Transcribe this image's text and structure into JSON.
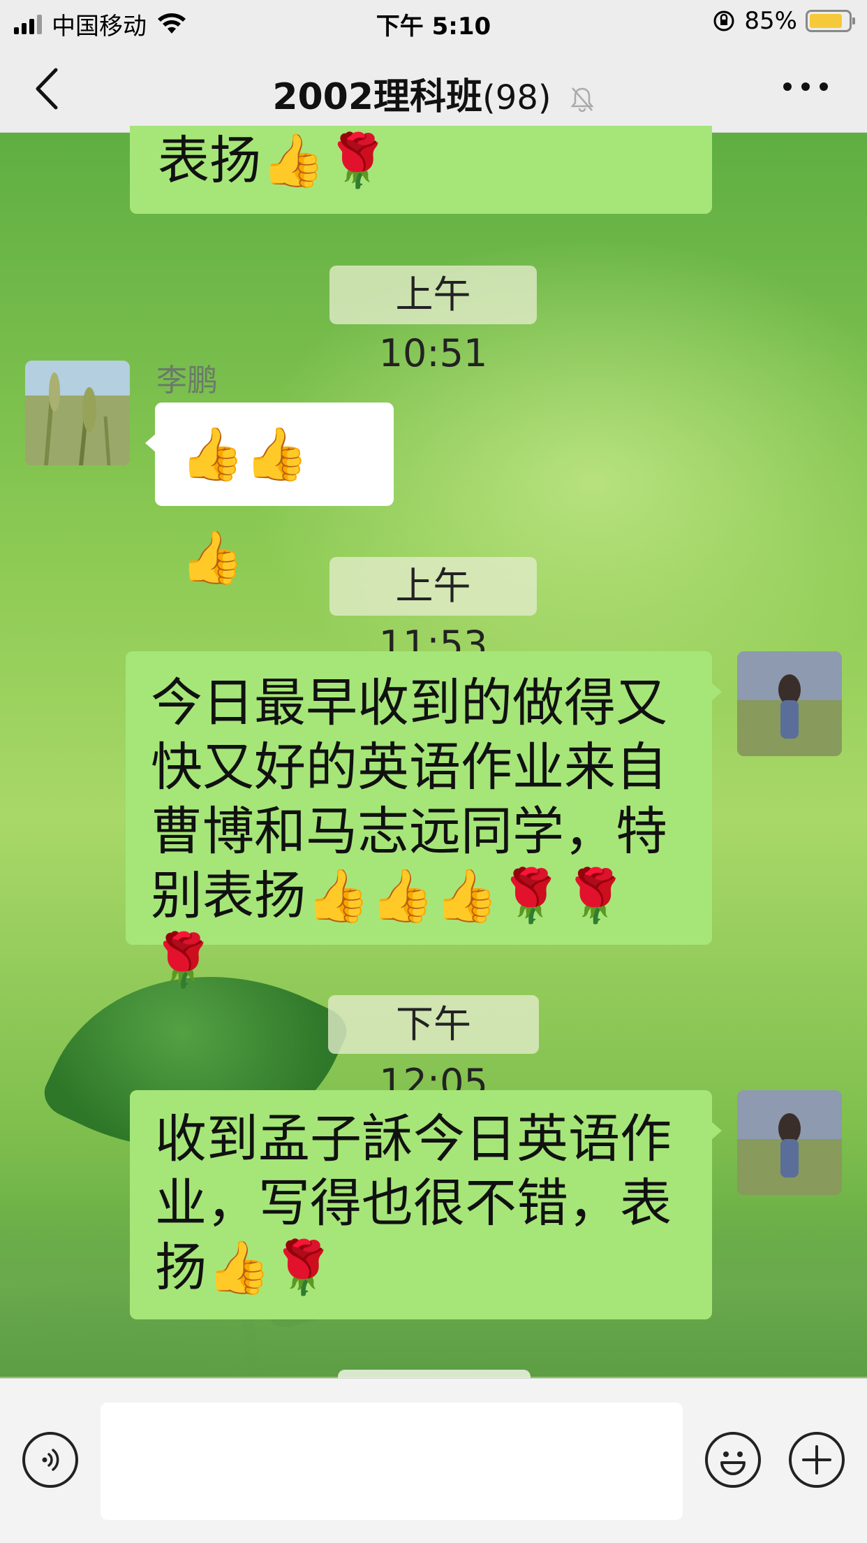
{
  "status_bar": {
    "carrier": "中国移动",
    "time": "下午 5:10",
    "battery": "85%",
    "battery_level": 0.85
  },
  "nav": {
    "title": "2002理科班",
    "member_count": "(98)",
    "icons": [
      "back-chevron-icon",
      "mute-bell-icon",
      "more-dots-icon"
    ]
  },
  "messages": [
    {
      "type": "partial_bubble",
      "text": "表扬👍🌹",
      "side": "right"
    },
    {
      "type": "timestamp",
      "text": "上午 10:51"
    },
    {
      "type": "bubble",
      "side": "left",
      "sender": "李鹏",
      "text": "👍👍👍"
    },
    {
      "type": "timestamp",
      "text": "上午 11:53"
    },
    {
      "type": "bubble",
      "side": "right",
      "lines": [
        "今日最早收到的做得又",
        "快又好的英语作业来自",
        "曹博和马志远同学，特",
        "别表扬👍👍👍🌹🌹🌹"
      ]
    },
    {
      "type": "timestamp",
      "text": "下午 12:05"
    },
    {
      "type": "bubble",
      "side": "right",
      "lines": [
        "收到孟子訸今日英语作",
        "业，写得也很不错，表",
        "扬👍🌹"
      ]
    }
  ],
  "input_bar": {
    "text_value": "",
    "icons": [
      "voice-icon",
      "emoji-icon",
      "plus-icon"
    ]
  }
}
